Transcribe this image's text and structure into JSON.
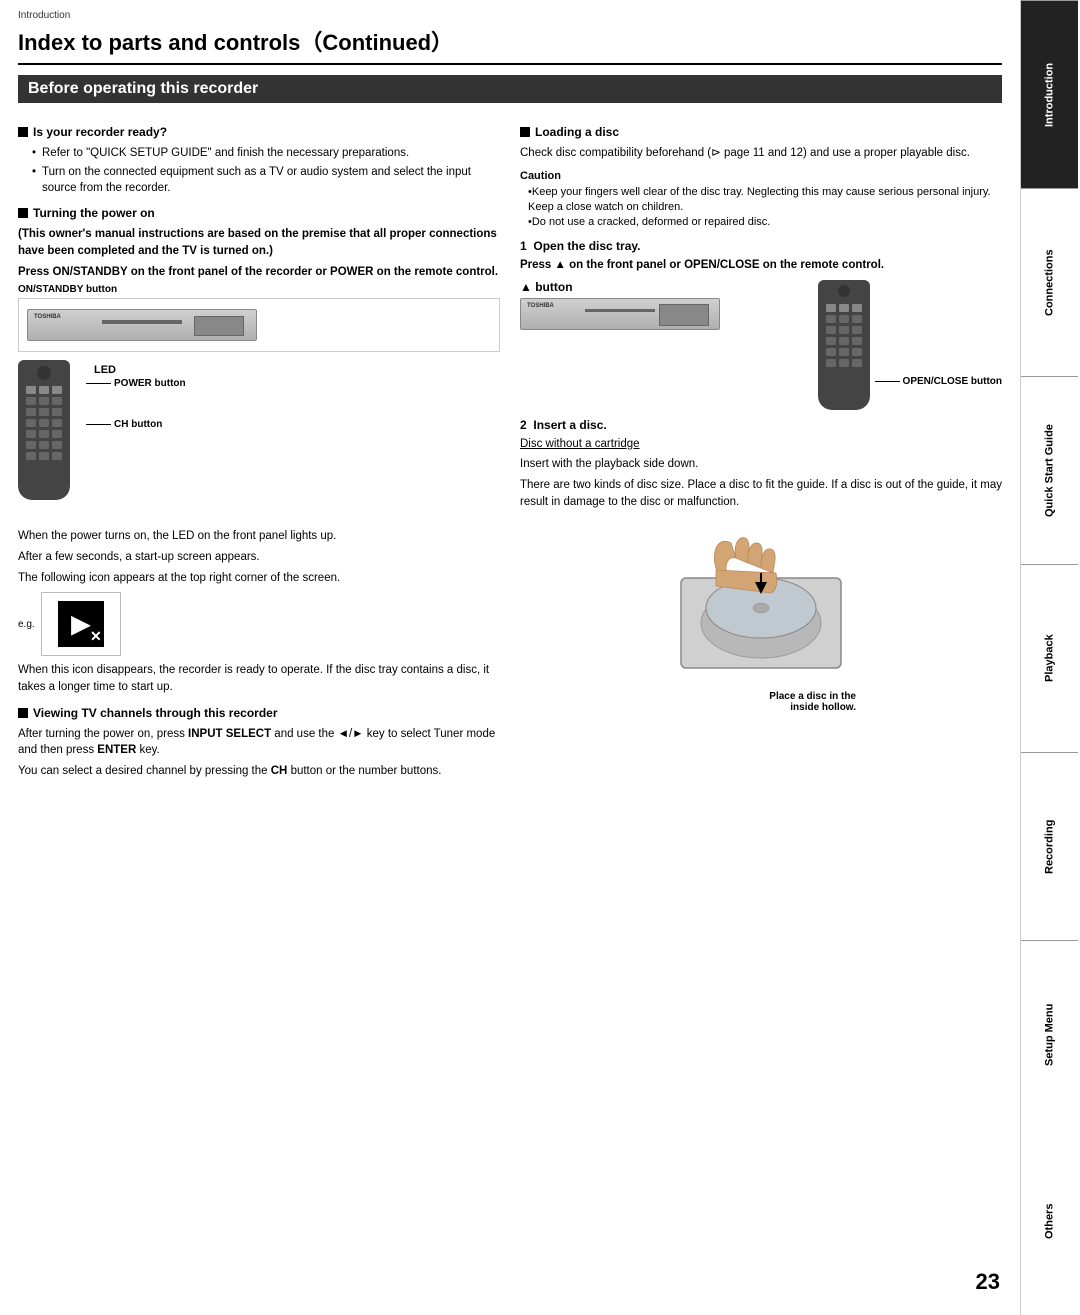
{
  "breadcrumb": "Introduction",
  "page_title": "Index to parts and controls（Continued）",
  "section_title": "Before operating this recorder",
  "sidebar": {
    "items": [
      {
        "label": "Introduction",
        "active": true
      },
      {
        "label": "Connections",
        "active": false
      },
      {
        "label": "Quick Start Guide",
        "active": false
      },
      {
        "label": "Playback",
        "active": false
      },
      {
        "label": "Recording",
        "active": false
      },
      {
        "label": "Setup Menu",
        "active": false
      },
      {
        "label": "Others",
        "active": false
      }
    ]
  },
  "left_col": {
    "is_recorder_ready": {
      "header": "Is your recorder ready?",
      "bullets": [
        "Refer to \"QUICK SETUP GUIDE\" and finish the necessary preparations.",
        "Turn on the connected equipment such as a TV or audio system and select the input source from the recorder."
      ]
    },
    "turning_power": {
      "header": "Turning the power on",
      "bold_text": "(This owner's manual instructions are based on the premise that all proper connections have been completed and the TV is turned on.)",
      "press_text": "Press ON/STANDBY on the front panel of the recorder or POWER on the remote control.",
      "on_standby_label": "ON/STANDBY button",
      "led_label": "LED",
      "power_button_label": "POWER button",
      "ch_button_label": "CH button",
      "after_text1": "When the power turns on, the LED on the front panel lights up.",
      "after_text2": "After a few seconds, a start-up screen appears.",
      "after_text3": "The following icon appears at the top right corner of the screen.",
      "eg_label": "e.g.",
      "disappear_text": "When this icon disappears, the recorder is ready to operate.  If the disc tray contains a disc, it takes a longer time to start up."
    },
    "viewing_tv": {
      "header": "Viewing TV channels through this recorder",
      "text1": "After turning the power on, press INPUT SELECT and use the ◄/► key to select Tuner mode and then press ENTER key.",
      "text2": "You can select a desired channel by pressing the CH button or the number buttons."
    }
  },
  "right_col": {
    "loading_disc": {
      "header": "Loading a disc",
      "text": "Check disc compatibility beforehand (⊳ page 11 and 12) and use a proper playable disc.",
      "caution_title": "Caution",
      "caution_bullets": [
        "Keep your fingers well clear of the disc tray. Neglecting this may cause serious personal injury. Keep a close watch on children.",
        "Do not use a cracked, deformed or repaired disc."
      ]
    },
    "step1": {
      "number": "1",
      "title": "Open the disc tray.",
      "press_text": "Press ▲ on the front panel or OPEN/CLOSE on the remote control.",
      "eject_button_label": "▲ button",
      "open_close_label": "OPEN/CLOSE button"
    },
    "step2": {
      "number": "2",
      "title": "Insert a disc.",
      "underline_text": "Disc without a cartridge",
      "text1": "Insert with the playback side down.",
      "text2": "There are two kinds of disc size. Place a disc to fit the guide. If a disc is out of the guide, it may result in damage to the disc or malfunction.",
      "place_caption_line1": "Place a disc in the",
      "place_caption_line2": "inside hollow."
    }
  },
  "page_number": "23"
}
